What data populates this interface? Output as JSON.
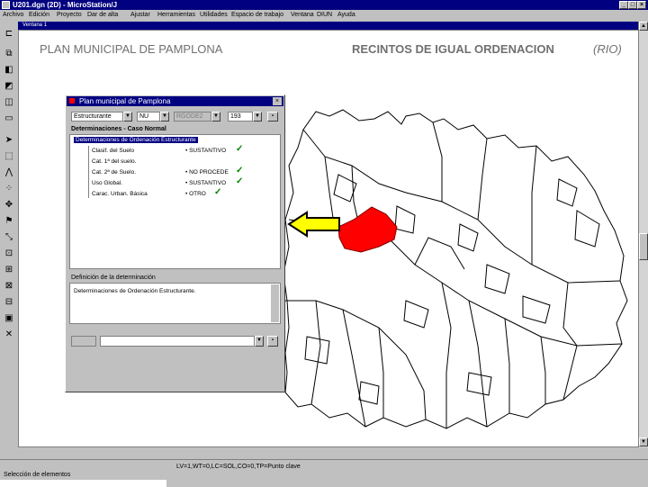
{
  "window": {
    "title": "U201.dgn (2D) - MicroStation/J",
    "view_title": "Ventana 1"
  },
  "menu": [
    "Archivo",
    "Edición",
    "Proyecto",
    "Dar de alta",
    "Ajustar",
    "Herramientas",
    "Utilidades",
    "Espacio de trabajo",
    "Ventana",
    "DIUN",
    "Ayuda"
  ],
  "slide": {
    "left_title": "PLAN MUNICIPAL DE PAMPLONA",
    "right_title": "RECINTOS DE IGUAL ORDENACION",
    "right_abbrev": "(RIO)"
  },
  "dialog": {
    "title": "Plan municipal de Pamplona",
    "combo1": "Estructurante",
    "combo2": "NU",
    "combo3": "RGODE2",
    "combo4": "193",
    "group_label": "Determinaciones - Caso Normal",
    "tree_root": "Determinaciones de Ordenación Estructurante",
    "rows": [
      {
        "label": "Clasif. del Suelo",
        "value": "• SUSTANTIVO",
        "checked": true
      },
      {
        "label": "Cat. 1ª del suelo.",
        "value": "",
        "checked": false
      },
      {
        "label": "Cat. 2ª de Suelo.",
        "value": "• NO PROCEDE",
        "checked": true
      },
      {
        "label": "Uso Global.",
        "value": "• SUSTANTIVO",
        "checked": true
      },
      {
        "label": "Carac. Urban. Básica",
        "value": "• OTRO",
        "checked": true
      }
    ],
    "definition_label": "Definición de la determinación",
    "definition_text": "Determinaciones de Ordenación Estructurante."
  },
  "status": {
    "left": "Selección de elementos",
    "center": "LV=1,WT=0,LC=SOL,CO=0,TP=Punto clave"
  },
  "colors": {
    "highlight": "#ff0000",
    "arrow": "#ffff00",
    "check": "#008000"
  }
}
